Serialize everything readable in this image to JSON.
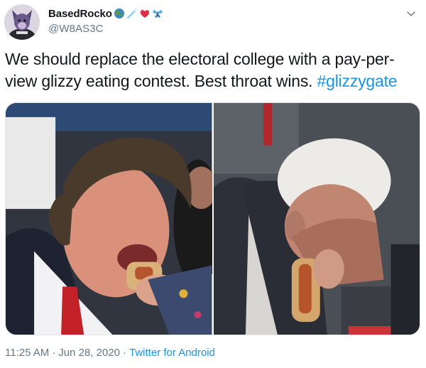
{
  "author": {
    "display_name": "BasedRocko",
    "handle": "@W8AS3C",
    "emojis": [
      "globe-emoji",
      "comet-emoji",
      "heart-emoji",
      "butterfly-emoji"
    ]
  },
  "tweet": {
    "text": "We should replace the electoral college with a pay-per-view glizzy eating contest. Best throat wins. ",
    "hashtag": "#glizzygate"
  },
  "media": {
    "images": [
      {
        "icon": "photo-man-eating-hotdog-left"
      },
      {
        "icon": "photo-man-eating-hotdog-right"
      }
    ]
  },
  "meta": {
    "time": "11:25 AM",
    "date": "Jun 28, 2020",
    "separator": "·",
    "source": "Twitter for Android"
  },
  "colors": {
    "link": "#1b95e0",
    "secondary": "#657786",
    "text": "#14171a"
  }
}
